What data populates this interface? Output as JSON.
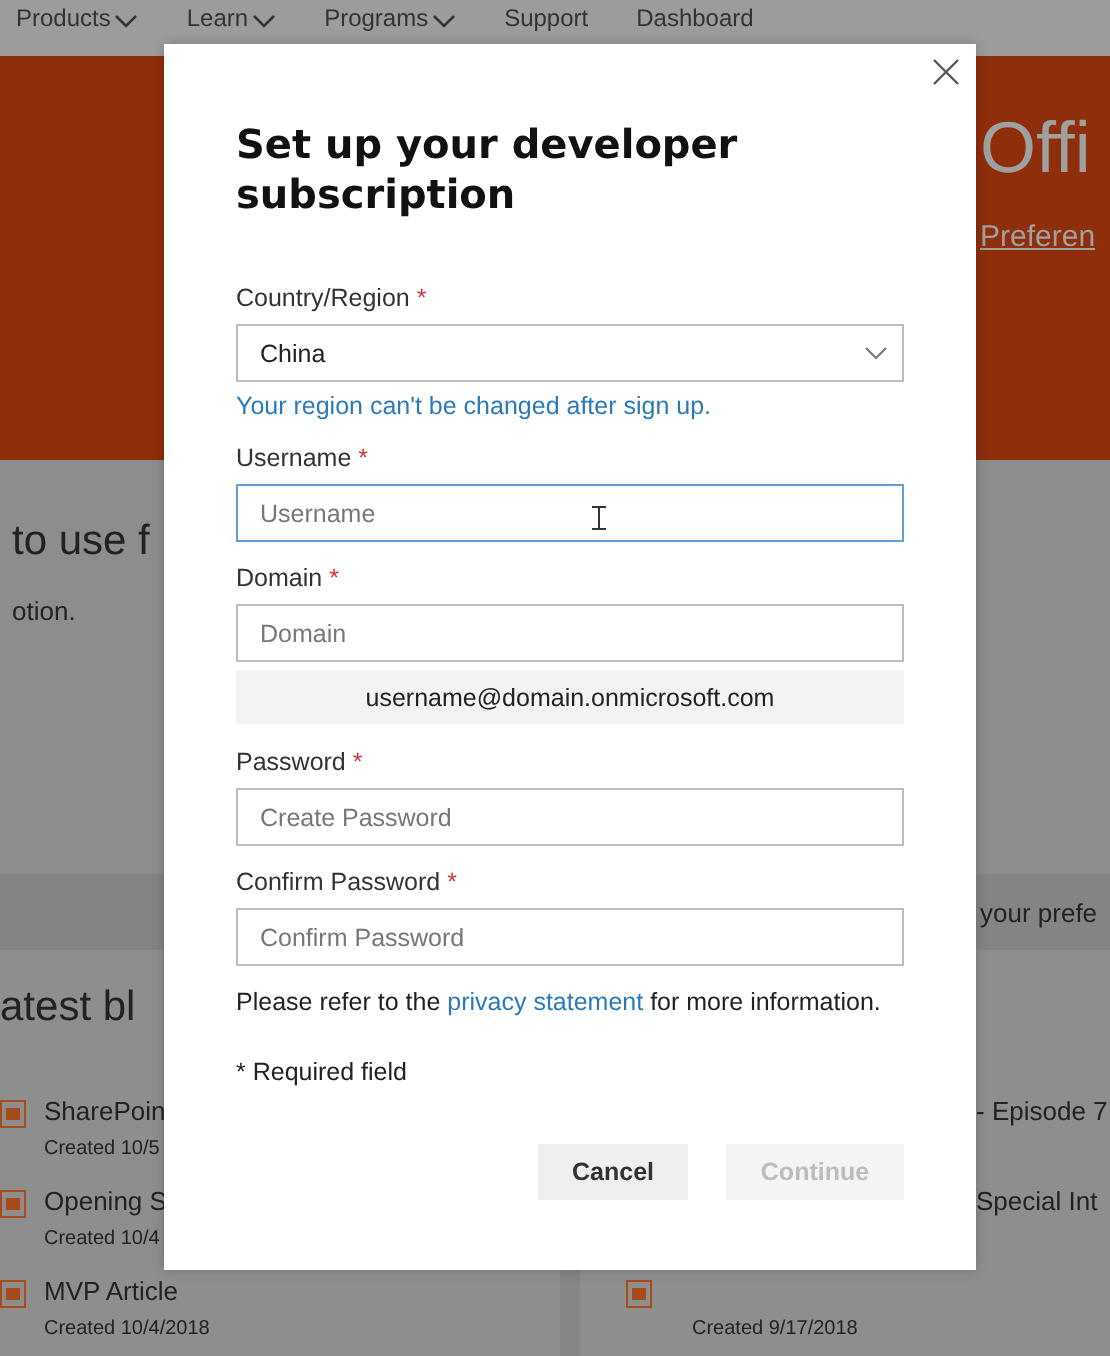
{
  "nav": {
    "items": [
      {
        "label": "Products",
        "dropdown": true
      },
      {
        "label": "Learn",
        "dropdown": true
      },
      {
        "label": "Programs",
        "dropdown": true
      },
      {
        "label": "Support",
        "dropdown": false
      },
      {
        "label": "Dashboard",
        "dropdown": false
      }
    ]
  },
  "hero": {
    "title": "Offi",
    "link": "Preferen"
  },
  "intro": {
    "heading": "to use f",
    "text": "otion."
  },
  "band": {
    "text": "your prefe"
  },
  "blog": {
    "heading": "atest bl",
    "left": [
      {
        "title": "SharePoin",
        "date": "Created 10/5"
      },
      {
        "title": "Opening S",
        "date": "Created 10/4"
      },
      {
        "title": "MVP Article",
        "date": "Created 10/4/2018"
      }
    ],
    "right": [
      {
        "title": "- Episode 7"
      },
      {
        "title": "Special Int"
      },
      {
        "date": "Created 9/17/2018"
      }
    ]
  },
  "dialog": {
    "title": "Set up your developer subscription",
    "required_mark": "*",
    "fields": [
      {
        "kind": "select",
        "label": "Country/Region",
        "required": true,
        "value": "China",
        "help": "Your region can't be changed after sign up.",
        "focused": false
      },
      {
        "kind": "input",
        "label": "Username",
        "required": true,
        "placeholder": "Username",
        "focused": true
      },
      {
        "kind": "input",
        "label": "Domain",
        "required": true,
        "placeholder": "Domain",
        "focused": false,
        "preview": "username@domain.onmicrosoft.com"
      },
      {
        "kind": "input",
        "label": "Password",
        "required": true,
        "placeholder": "Create Password",
        "focused": false
      },
      {
        "kind": "input",
        "label": "Confirm Password",
        "required": true,
        "placeholder": "Confirm Password",
        "focused": false
      }
    ],
    "privacy": {
      "before": "Please refer to the ",
      "link": "privacy statement",
      "after": " for more information."
    },
    "note": "* Required field",
    "buttons": [
      {
        "label": "Cancel",
        "disabled": false
      },
      {
        "label": "Continue",
        "disabled": true
      }
    ]
  }
}
